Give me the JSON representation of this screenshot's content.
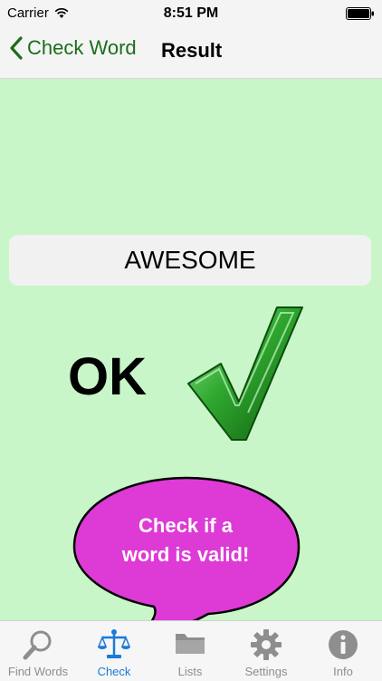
{
  "status": {
    "carrier": "Carrier",
    "time": "8:51 PM"
  },
  "nav": {
    "back_label": "Check Word",
    "title": "Result"
  },
  "result": {
    "word": "AWESOME",
    "verdict": "OK"
  },
  "bubble": {
    "line1": "Check if a",
    "line2": "word is valid!"
  },
  "tabs": [
    {
      "label": "Find Words",
      "icon": "magnifier-icon"
    },
    {
      "label": "Check",
      "icon": "scales-icon",
      "active": true
    },
    {
      "label": "Lists",
      "icon": "folder-icon"
    },
    {
      "label": "Settings",
      "icon": "gear-icon"
    },
    {
      "label": "Info",
      "icon": "info-icon"
    }
  ],
  "colors": {
    "background": "#c8f6c8",
    "nav_tint": "#1b6e1b",
    "bubble": "#de3ad6",
    "check": "#2fa82f",
    "tab_active": "#1a7ad9"
  }
}
